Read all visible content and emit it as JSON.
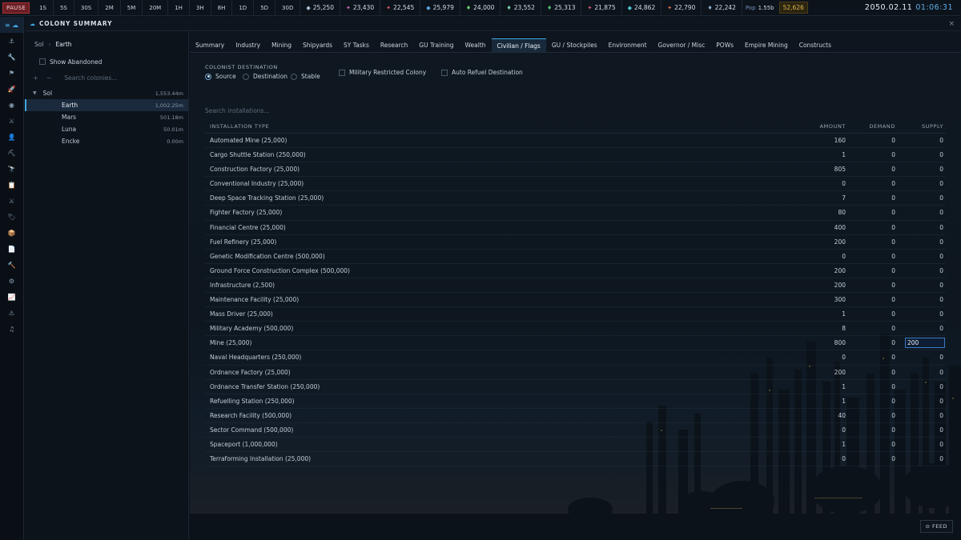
{
  "topbar": {
    "pause_label": "PAUSE",
    "speeds": [
      "1S",
      "5S",
      "30S",
      "2M",
      "5M",
      "20M",
      "1H",
      "3H",
      "8H",
      "1D",
      "5D",
      "30D"
    ],
    "resources": [
      {
        "icon": "duranium-icon",
        "glyph": "◆",
        "color": "#b0c4d8",
        "value": "25,250"
      },
      {
        "icon": "neutronium-icon",
        "glyph": "✦",
        "color": "#d070c0",
        "value": "23,430"
      },
      {
        "icon": "corbomite-icon",
        "glyph": "✦",
        "color": "#e05a6a",
        "value": "22,545"
      },
      {
        "icon": "tritanium-icon",
        "glyph": "◆",
        "color": "#5aa8e0",
        "value": "25,979"
      },
      {
        "icon": "boronide-icon",
        "glyph": "♦",
        "color": "#6ad070",
        "value": "24,000"
      },
      {
        "icon": "mercassium-icon",
        "glyph": "♦",
        "color": "#7ad0b0",
        "value": "23,552"
      },
      {
        "icon": "vendarite-icon",
        "glyph": "♦",
        "color": "#50c070",
        "value": "25,313"
      },
      {
        "icon": "sorium-icon",
        "glyph": "✦",
        "color": "#e06080",
        "value": "21,875"
      },
      {
        "icon": "uridium-icon",
        "glyph": "◆",
        "color": "#50c8d8",
        "value": "24,862"
      },
      {
        "icon": "corundium-icon",
        "glyph": "✦",
        "color": "#e07050",
        "value": "22,790"
      },
      {
        "icon": "gallicite-icon",
        "glyph": "♦",
        "color": "#8ab0d0",
        "value": "22,242"
      }
    ],
    "pop_label": "Pop",
    "pop_value": "1.55b",
    "wealth": "52,626",
    "date": "2050.02.11",
    "time": "01:06:31"
  },
  "rail": {
    "items": [
      {
        "icon": "colony-icon",
        "glyph": "≡ ☁",
        "active": true
      },
      {
        "icon": "anchor-icon",
        "glyph": "⚓"
      },
      {
        "icon": "wrench-icon",
        "glyph": "🔧"
      },
      {
        "icon": "flag-icon",
        "glyph": "⚑"
      },
      {
        "icon": "rocket-icon",
        "glyph": "🚀"
      },
      {
        "icon": "target-icon",
        "glyph": "◉"
      },
      {
        "icon": "swords-icon",
        "glyph": "⚔"
      },
      {
        "icon": "person-icon",
        "glyph": "👤"
      },
      {
        "icon": "pickaxe-icon",
        "glyph": "⛏"
      },
      {
        "icon": "telescope-icon",
        "glyph": "🔭"
      },
      {
        "icon": "clipboard-icon",
        "glyph": "📋"
      },
      {
        "icon": "crossed-swords-icon",
        "glyph": "⚔"
      },
      {
        "icon": "tag-icon",
        "glyph": "🏷"
      },
      {
        "icon": "package-icon",
        "glyph": "📦"
      },
      {
        "icon": "document-icon",
        "glyph": "📄"
      },
      {
        "icon": "hammer-icon",
        "glyph": "🔨"
      },
      {
        "icon": "settings-icon",
        "glyph": "⚙"
      },
      {
        "icon": "chart-icon",
        "glyph": "📈"
      },
      {
        "icon": "warning-icon",
        "glyph": "⚠"
      },
      {
        "icon": "music-icon",
        "glyph": "♫"
      }
    ]
  },
  "window": {
    "title": "COLONY SUMMARY",
    "close_glyph": "×"
  },
  "left": {
    "crumb_root": "Sol",
    "crumb_sep": "›",
    "crumb_current": "Earth",
    "show_abandoned": "Show Abandoned",
    "expand_glyph": "+",
    "collapse_glyph": "−",
    "search_placeholder": "Search colonies...",
    "system": {
      "arrow": "▼",
      "name": "Sol",
      "value": "1,553.44m"
    },
    "bodies": [
      {
        "name": "Earth",
        "value": "1,002.25m",
        "selected": true
      },
      {
        "name": "Mars",
        "value": "501.18m"
      },
      {
        "name": "Luna",
        "value": "50.01m"
      },
      {
        "name": "Encke",
        "value": "0.00m"
      }
    ]
  },
  "tabs": [
    "Summary",
    "Industry",
    "Mining",
    "Shipyards",
    "SY Tasks",
    "Research",
    "GU Training",
    "Wealth",
    "Civilian / Flags",
    "GU / Stockpiles",
    "Environment",
    "Governor / Misc",
    "POWs",
    "Empire Mining",
    "Constructs"
  ],
  "active_tab": "Civilian / Flags",
  "civilian": {
    "destination_title": "COLONIST DESTINATION",
    "source": "Source",
    "destination": "Destination",
    "stable": "Stable",
    "military_restricted": "Military Restricted Colony",
    "auto_refuel": "Auto Refuel Destination",
    "search_placeholder": "Search installations...",
    "headers": {
      "type": "INSTALLATION TYPE",
      "amount": "AMOUNT",
      "demand": "DEMAND",
      "supply": "SUPPLY"
    },
    "rows": [
      {
        "name": "Automated Mine (25,000)",
        "amount": "160",
        "demand": "0",
        "supply": "0"
      },
      {
        "name": "Cargo Shuttle Station (250,000)",
        "amount": "1",
        "demand": "0",
        "supply": "0"
      },
      {
        "name": "Construction Factory (25,000)",
        "amount": "805",
        "demand": "0",
        "supply": "0"
      },
      {
        "name": "Conventional Industry (25,000)",
        "amount": "0",
        "demand": "0",
        "supply": "0"
      },
      {
        "name": "Deep Space Tracking Station (25,000)",
        "amount": "7",
        "demand": "0",
        "supply": "0"
      },
      {
        "name": "Fighter Factory (25,000)",
        "amount": "80",
        "demand": "0",
        "supply": "0"
      },
      {
        "name": "Financial Centre (25,000)",
        "amount": "400",
        "demand": "0",
        "supply": "0"
      },
      {
        "name": "Fuel Refinery (25,000)",
        "amount": "200",
        "demand": "0",
        "supply": "0"
      },
      {
        "name": "Genetic Modification Centre (500,000)",
        "amount": "0",
        "demand": "0",
        "supply": "0"
      },
      {
        "name": "Ground Force Construction Complex (500,000)",
        "amount": "200",
        "demand": "0",
        "supply": "0"
      },
      {
        "name": "Infrastructure (2,500)",
        "amount": "200",
        "demand": "0",
        "supply": "0"
      },
      {
        "name": "Maintenance Facility (25,000)",
        "amount": "300",
        "demand": "0",
        "supply": "0"
      },
      {
        "name": "Mass Driver (25,000)",
        "amount": "1",
        "demand": "0",
        "supply": "0"
      },
      {
        "name": "Military Academy (500,000)",
        "amount": "8",
        "demand": "0",
        "supply": "0"
      },
      {
        "name": "Mine (25,000)",
        "amount": "800",
        "demand": "0",
        "supply": "200",
        "editing": true
      },
      {
        "name": "Naval Headquarters (250,000)",
        "amount": "0",
        "demand": "0",
        "supply": "0"
      },
      {
        "name": "Ordnance Factory (25,000)",
        "amount": "200",
        "demand": "0",
        "supply": "0"
      },
      {
        "name": "Ordnance Transfer Station (250,000)",
        "amount": "1",
        "demand": "0",
        "supply": "0"
      },
      {
        "name": "Refuelling Station (250,000)",
        "amount": "1",
        "demand": "0",
        "supply": "0"
      },
      {
        "name": "Research Facility (500,000)",
        "amount": "40",
        "demand": "0",
        "supply": "0"
      },
      {
        "name": "Sector Command (500,000)",
        "amount": "0",
        "demand": "0",
        "supply": "0"
      },
      {
        "name": "Spaceport (1,000,000)",
        "amount": "1",
        "demand": "0",
        "supply": "0"
      },
      {
        "name": "Terraforming Installation (25,000)",
        "amount": "0",
        "demand": "0",
        "supply": "0"
      }
    ]
  },
  "feed_label": "FEED",
  "feed_glyph": "⊙"
}
